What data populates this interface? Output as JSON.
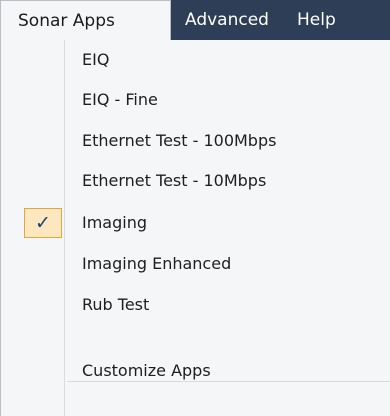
{
  "menubar": {
    "items": [
      {
        "label": "Sonar Apps"
      },
      {
        "label": "Advanced"
      },
      {
        "label": "Help"
      }
    ]
  },
  "dropdown": {
    "items": [
      {
        "label": "EIQ",
        "checked": false
      },
      {
        "label": "EIQ - Fine",
        "checked": false
      },
      {
        "label": "Ethernet Test - 100Mbps",
        "checked": false
      },
      {
        "label": "Ethernet Test - 10Mbps",
        "checked": false
      },
      {
        "label": "Imaging",
        "checked": true
      },
      {
        "label": "Imaging Enhanced",
        "checked": false
      },
      {
        "label": "Rub Test",
        "checked": false
      }
    ],
    "footer_item": {
      "label": "Customize Apps"
    },
    "check_glyph": "✓",
    "colors": {
      "menubar_bg": "#2e3e57",
      "menu_bg": "#f5f6f7",
      "check_bg": "#fde7bf",
      "check_border": "#e3a63a",
      "check_color": "#1d3f7a"
    }
  }
}
